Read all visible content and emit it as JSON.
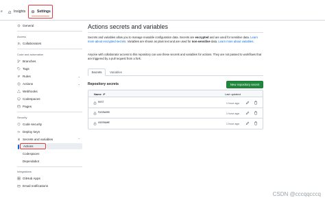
{
  "topnav": {
    "edge_text": "e",
    "insights_label": "Insights",
    "settings_label": "Settings"
  },
  "sidebar": {
    "general": "General",
    "access_section": "Access",
    "collaborators": "Collaborators",
    "code_section": "Code and automation",
    "branches": "Branches",
    "tags": "Tags",
    "rules": "Rules",
    "actions": "Actions",
    "webhooks": "Webhooks",
    "codespaces": "Codespaces",
    "pages": "Pages",
    "security_section": "Security",
    "code_security": "Code security",
    "deploy_keys": "Deploy keys",
    "secrets_vars": "Secrets and variables",
    "sub_actions": "Actions",
    "sub_codespaces": "Codespaces",
    "sub_dependabot": "Dependabot",
    "integrations_section": "Integrations",
    "github_apps": "GitHub Apps",
    "email_notifications": "Email notifications"
  },
  "main": {
    "title": "Actions secrets and variables",
    "intro_a": "Secrets and variables allow you to manage reusable configuration data. Secrets are ",
    "intro_b": "encrypted",
    "intro_c": " and are used for sensitive data. ",
    "intro_link1": "Learn more about encrypted secrets",
    "intro_d": ". Variables are shown as plain text and are used for ",
    "intro_e": "non-sensitive",
    "intro_f": " data. ",
    "intro_link2": "Learn more about variables",
    "intro_g": ".",
    "collab_note": "Anyone with collaborator access to this repository can use these secrets and variables for actions. They are not passed to workflows that are triggered by a pull request from a fork.",
    "tab_secrets": "Secrets",
    "tab_variables": "Variables",
    "repo_secrets_heading": "Repository secrets",
    "new_secret_button": "New repository secret",
    "col_name": "Name ↓F",
    "col_updated": "Last updated",
    "secrets": [
      {
        "name": "HOST",
        "updated": "1 hour ago"
      },
      {
        "name": "PASSWORD",
        "updated": "1 hour ago"
      },
      {
        "name": "USERNAME",
        "updated": "1 hour ago"
      }
    ]
  },
  "watermark": "CSDN @cccqqcccq",
  "colors": {
    "accent_blue": "#0969da",
    "primary_green": "#1f883d",
    "highlight_red": "#e5383b",
    "tab_underline": "#fd8c73"
  }
}
